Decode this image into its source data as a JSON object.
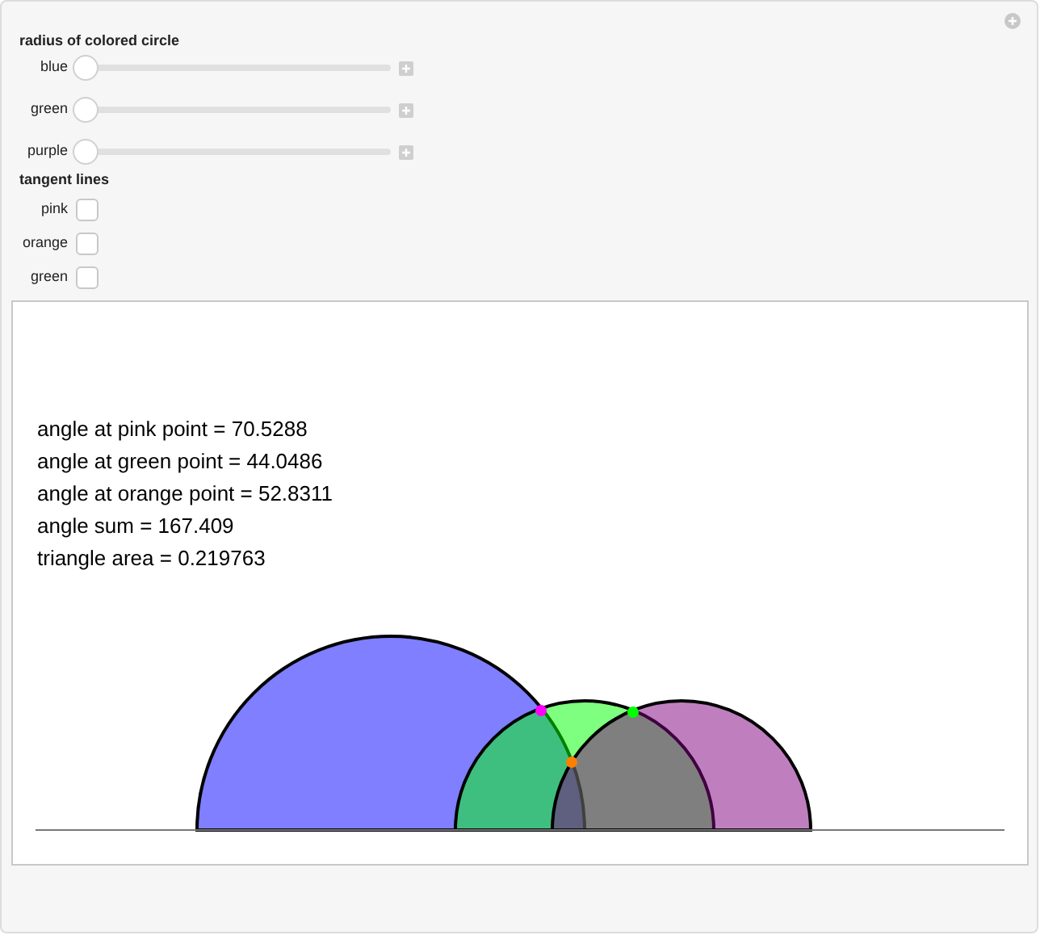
{
  "radius_section": {
    "title": "radius of colored circle",
    "sliders": [
      {
        "label": "blue",
        "level": 0
      },
      {
        "label": "green",
        "level": 0
      },
      {
        "label": "purple",
        "level": 0
      }
    ]
  },
  "tangent_section": {
    "title": "tangent lines",
    "checkboxes": [
      {
        "label": "pink",
        "checked": false
      },
      {
        "label": "orange",
        "checked": false
      },
      {
        "label": "green",
        "checked": false
      }
    ]
  },
  "plot": {
    "lines": [
      "angle at pink point = 70.5288",
      "angle at green point = 44.0486",
      "angle at orange point = 52.8311",
      "angle sum = 167.409",
      "triangle area = 0.219763"
    ],
    "points": [
      {
        "color": "#ff00ff"
      },
      {
        "color": "#00ff00"
      },
      {
        "color": "#ff8000"
      }
    ]
  }
}
